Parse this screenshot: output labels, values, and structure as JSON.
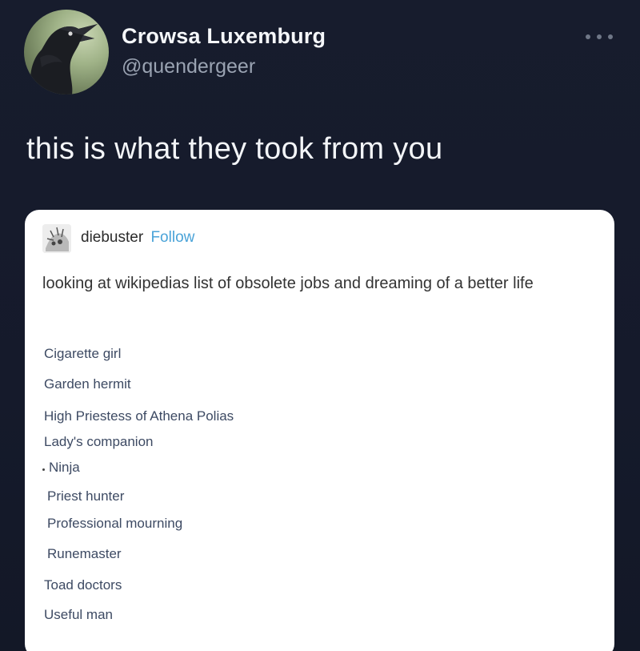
{
  "tweet": {
    "display_name": "Crowsa Luxemburg",
    "handle": "@quendergeer",
    "text": "this is what they took from you",
    "more_icon": "more-horizontal-icon"
  },
  "embed": {
    "username": "diebuster",
    "follow_label": "Follow",
    "post_text": "looking at wikipedias list of obsolete jobs and dreaming of a better life",
    "jobs": [
      "Cigarette girl",
      "Garden hermit",
      "High Priestess of Athena Polias",
      "Lady's companion",
      "Ninja",
      "Priest hunter",
      "Professional mourning",
      "Runemaster",
      "Toad doctors",
      "Useful man"
    ]
  },
  "colors": {
    "background": "#161b2c",
    "handle": "#9aa3b2",
    "follow_link": "#4aa3d8",
    "job_link": "#3d4a63"
  }
}
